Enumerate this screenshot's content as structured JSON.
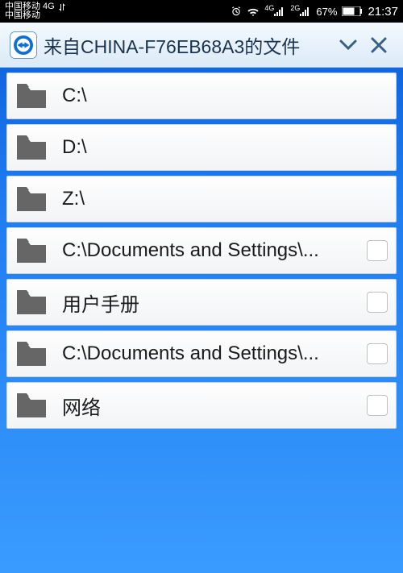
{
  "statusbar": {
    "carrier_top": "中国移动 4G",
    "carrier_bottom": "中国移动",
    "net1_sup": "4G",
    "net2_sup": "2G",
    "battery_pct": "67%",
    "time": "21:37"
  },
  "header": {
    "title": "来自CHINA-F76EB68A3的文件"
  },
  "files": [
    {
      "label": "C:\\",
      "has_checkbox": false
    },
    {
      "label": "D:\\",
      "has_checkbox": false
    },
    {
      "label": "Z:\\",
      "has_checkbox": false
    },
    {
      "label": "C:\\Documents and Settings\\...",
      "has_checkbox": true
    },
    {
      "label": "用户手册",
      "has_checkbox": true
    },
    {
      "label": "C:\\Documents and Settings\\...",
      "has_checkbox": true
    },
    {
      "label": "网络",
      "has_checkbox": true
    }
  ]
}
